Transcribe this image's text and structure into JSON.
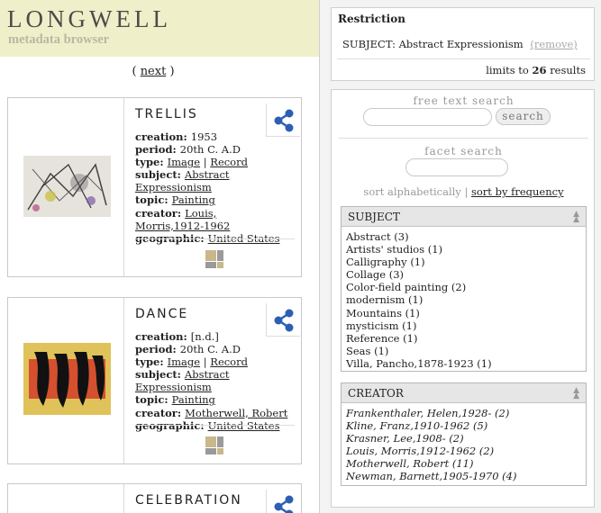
{
  "header": {
    "logo": "LONGWELL",
    "tagline": "metadata browser"
  },
  "pager": {
    "open": "(",
    "next_label": "next",
    "close": ")"
  },
  "items": [
    {
      "title": "TRELLIS",
      "fields": [
        {
          "key": "creation:",
          "parts": [
            {
              "text": "1953",
              "link": false
            }
          ]
        },
        {
          "key": "period:",
          "parts": [
            {
              "text": "20th C. A.D",
              "link": false
            }
          ]
        },
        {
          "key": "type:",
          "parts": [
            {
              "text": "Image",
              "link": true
            },
            {
              "text": " | ",
              "link": false
            },
            {
              "text": "Record",
              "link": true
            }
          ]
        },
        {
          "key": "subject:",
          "parts": [
            {
              "text": "Abstract Expressionism",
              "link": true
            }
          ]
        },
        {
          "key": "topic:",
          "parts": [
            {
              "text": "Painting",
              "link": true
            }
          ]
        },
        {
          "key": "creator:",
          "parts": [
            {
              "text": "Louis,",
              "link": true
            }
          ]
        },
        {
          "key": "",
          "parts": [
            {
              "text": "Morris,1912-1962",
              "link": true
            }
          ]
        },
        {
          "key": "geographic:",
          "parts": [
            {
              "text": "United States",
              "link": true
            }
          ]
        }
      ]
    },
    {
      "title": "DANCE",
      "fields": [
        {
          "key": "creation:",
          "parts": [
            {
              "text": "[n.d.]",
              "link": false
            }
          ]
        },
        {
          "key": "period:",
          "parts": [
            {
              "text": "20th C. A.D",
              "link": false
            }
          ]
        },
        {
          "key": "type:",
          "parts": [
            {
              "text": "Image",
              "link": true
            },
            {
              "text": " | ",
              "link": false
            },
            {
              "text": "Record",
              "link": true
            }
          ]
        },
        {
          "key": "subject:",
          "parts": [
            {
              "text": "Abstract Expressionism",
              "link": true
            }
          ]
        },
        {
          "key": "topic:",
          "parts": [
            {
              "text": "Painting",
              "link": true
            }
          ]
        },
        {
          "key": "creator:",
          "parts": [
            {
              "text": "Motherwell, Robert",
              "link": true
            }
          ]
        },
        {
          "key": "geographic:",
          "parts": [
            {
              "text": "United States",
              "link": true
            }
          ]
        }
      ]
    },
    {
      "title": "CELEBRATION",
      "fields": []
    }
  ],
  "restriction": {
    "title": "Restriction",
    "subject_text": "SUBJECT: Abstract Expressionism",
    "remove_label": "(remove)",
    "limits_prefix": "limits to",
    "limits_count": "26",
    "limits_suffix": "results"
  },
  "search": {
    "free_text_label": "free text search",
    "search_button": "search",
    "facet_search_label": "facet search",
    "sort_alpha": "sort alphabetically",
    "sort_divider": "|",
    "sort_freq": "sort by frequency"
  },
  "facets": [
    {
      "title": "SUBJECT",
      "style": "plain",
      "values": [
        "Abstract (3)",
        "Artists' studios (1)",
        "Calligraphy (1)",
        "Collage (3)",
        "Color-field painting (2)",
        "modernism (1)",
        "Mountains (1)",
        "mysticism (1)",
        "Reference (1)",
        "Seas (1)",
        "Villa, Pancho,1878-1923 (1)"
      ]
    },
    {
      "title": "CREATOR",
      "style": "italic",
      "values": [
        "Frankenthaler, Helen,1928- (2)",
        "Kline, Franz,1910-1962 (5)",
        "Krasner, Lee,1908- (2)",
        "Louis, Morris,1912-1962 (2)",
        "Motherwell, Robert (11)",
        "Newman, Barnett,1905-1970 (4)"
      ]
    }
  ],
  "icons": {
    "share": "share-icon",
    "grid": "grid-view-icon",
    "collapse": "collapse-icon"
  },
  "colors": {
    "header_bg": "#efefc9",
    "link_blue": "#2c5fb3",
    "panel_bg": "#f3f3f3",
    "grid_icon": "#c8b88a"
  }
}
